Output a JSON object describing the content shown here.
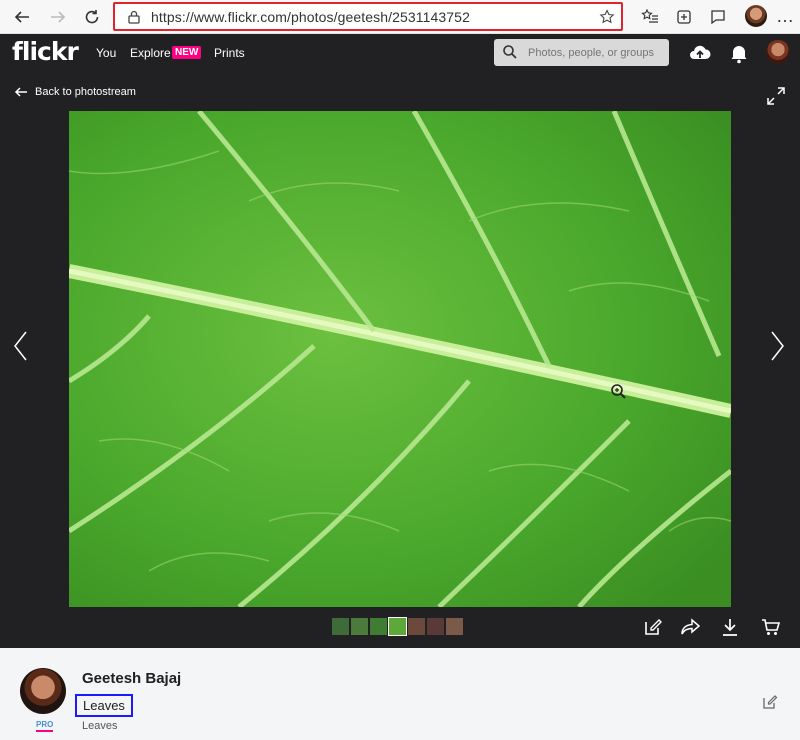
{
  "browser": {
    "url": "https://www.flickr.com/photos/geetesh/2531143752"
  },
  "header": {
    "logo": "flickr",
    "nav": {
      "you": "You",
      "explore": "Explore",
      "new_badge": "NEW",
      "prints": "Prints"
    },
    "search_placeholder": "Photos, people, or groups"
  },
  "photo_page": {
    "back_label": "Back to photostream",
    "thumbnails": [
      {
        "color": "#3f6b3a"
      },
      {
        "color": "#4c7a3c"
      },
      {
        "color": "#3e7d32"
      },
      {
        "color": "#5ea83a"
      },
      {
        "color": "#6b4a3c"
      },
      {
        "color": "#5a3a38"
      },
      {
        "color": "#7a5a48"
      }
    ]
  },
  "info": {
    "owner_name": "Geetesh Bajaj",
    "pro_label": "PRO",
    "title": "Leaves",
    "description": "Leaves"
  },
  "colors": {
    "header_bg": "#212124",
    "accent_pink": "#ff0084",
    "highlight_red": "#e0242e",
    "highlight_blue": "#1a1aff"
  }
}
